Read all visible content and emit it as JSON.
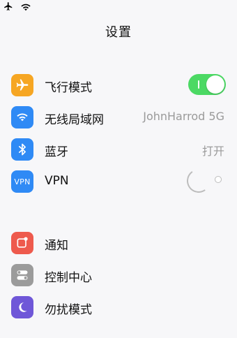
{
  "status_bar": {
    "airplane_icon": "airplane-icon",
    "wifi_icon": "wifi-icon"
  },
  "header": {
    "title": "设置"
  },
  "sections": [
    {
      "items": [
        {
          "label": "飞行模式",
          "icon": "airplane-icon",
          "icon_color": "#f6a623",
          "control": "toggle",
          "toggle_on": true
        },
        {
          "label": "无线局域网",
          "icon": "wifi-icon",
          "icon_color": "#2f8af5",
          "value": "JohnHarrod 5G"
        },
        {
          "label": "蓝牙",
          "icon": "bluetooth-icon",
          "icon_color": "#2f8af5",
          "value": "打开"
        },
        {
          "label": "VPN",
          "icon": "vpn-icon",
          "icon_color": "#2f8af5",
          "icon_text": "VPN",
          "control": "loading"
        }
      ]
    },
    {
      "items": [
        {
          "label": "通知",
          "icon": "notifications-icon",
          "icon_color": "#ee5a4d"
        },
        {
          "label": "控制中心",
          "icon": "control-center-icon",
          "icon_color": "#9b9b9b"
        },
        {
          "label": "勿扰模式",
          "icon": "moon-icon",
          "icon_color": "#6f57d8"
        }
      ]
    }
  ]
}
